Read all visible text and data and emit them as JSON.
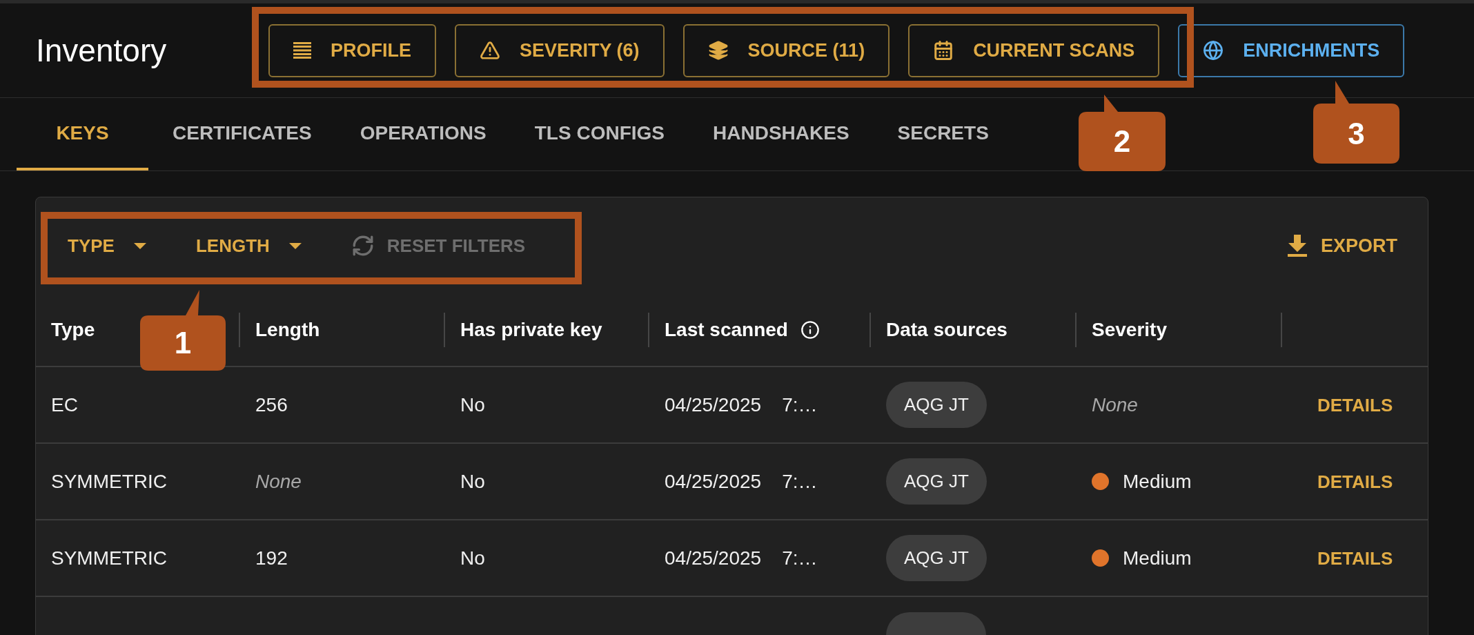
{
  "header": {
    "title": "Inventory",
    "buttons": [
      {
        "label": "PROFILE",
        "kind": "profile"
      },
      {
        "label": "SEVERITY (6)",
        "kind": "severity"
      },
      {
        "label": "SOURCE (11)",
        "kind": "source"
      },
      {
        "label": "CURRENT SCANS",
        "kind": "scans"
      },
      {
        "label": "ENRICHMENTS",
        "kind": "enrichments"
      }
    ]
  },
  "tabs": [
    {
      "label": "KEYS",
      "selected": true
    },
    {
      "label": "CERTIFICATES",
      "selected": false
    },
    {
      "label": "OPERATIONS",
      "selected": false
    },
    {
      "label": "TLS CONFIGS",
      "selected": false
    },
    {
      "label": "HANDSHAKES",
      "selected": false
    },
    {
      "label": "SECRETS",
      "selected": false
    }
  ],
  "filters": {
    "dropdowns": [
      {
        "label": "TYPE"
      },
      {
        "label": "LENGTH"
      }
    ],
    "reset": {
      "label": "RESET FILTERS",
      "disabled": true
    },
    "export": {
      "label": "EXPORT"
    }
  },
  "table": {
    "columns": [
      {
        "label": "Type"
      },
      {
        "label": "Length"
      },
      {
        "label": "Has private key"
      },
      {
        "label": "Last scanned",
        "info": true
      },
      {
        "label": "Data sources"
      },
      {
        "label": "Severity"
      }
    ],
    "rows": [
      {
        "type": "EC",
        "length": {
          "text": "256",
          "missing": false
        },
        "has_private_key": "No",
        "last_scanned": {
          "date": "04/25/2025",
          "time": "7:…"
        },
        "data_source": "AQG JT",
        "severity": {
          "text": "None",
          "kind": "none"
        },
        "action": "DETAILS"
      },
      {
        "type": "SYMMETRIC",
        "length": {
          "text": "None",
          "missing": true
        },
        "has_private_key": "No",
        "last_scanned": {
          "date": "04/25/2025",
          "time": "7:…"
        },
        "data_source": "AQG JT",
        "severity": {
          "text": "Medium",
          "kind": "dot",
          "color": "#e0742b"
        },
        "action": "DETAILS"
      },
      {
        "type": "SYMMETRIC",
        "length": {
          "text": "192",
          "missing": false
        },
        "has_private_key": "No",
        "last_scanned": {
          "date": "04/25/2025",
          "time": "7:…"
        },
        "data_source": "AQG JT",
        "severity": {
          "text": "Medium",
          "kind": "dot",
          "color": "#e0742b"
        },
        "action": "DETAILS"
      }
    ]
  },
  "annotations": [
    {
      "number": "1"
    },
    {
      "number": "2"
    },
    {
      "number": "3"
    }
  ]
}
